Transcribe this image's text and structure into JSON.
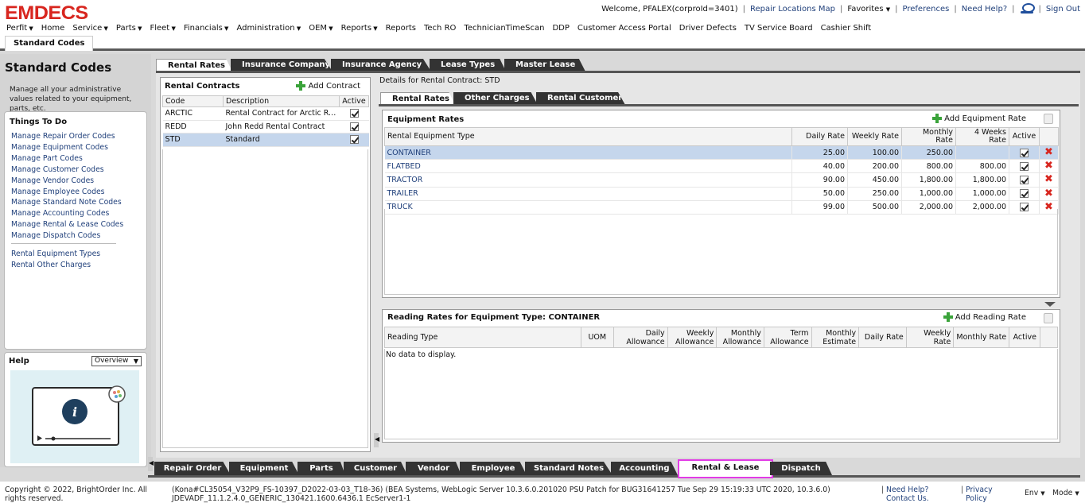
{
  "header": {
    "logo": "EMDECS",
    "welcome": "Welcome, PFALEX(corproId=3401)",
    "repair_map": "Repair Locations Map",
    "favorites": "Favorites",
    "preferences": "Preferences",
    "need_help": "Need Help?",
    "sign_out": "Sign Out"
  },
  "menu": [
    "Perfit",
    "Home",
    "Service",
    "Parts",
    "Fleet",
    "Financials",
    "Administration",
    "OEM",
    "Reports",
    "Reports",
    "Tech RO",
    "TechnicianTimeScan",
    "DDP",
    "Customer Access Portal",
    "Driver Defects",
    "TV Service Board",
    "Cashier Shift"
  ],
  "menu_carets": [
    true,
    false,
    true,
    true,
    true,
    true,
    true,
    true,
    true,
    false,
    false,
    false,
    false,
    false,
    false,
    false,
    false
  ],
  "subtab": "Standard Codes",
  "left": {
    "title": "Standard Codes",
    "description": "Manage all your administrative values related to your equipment, parts, etc.",
    "todo_title": "Things To Do",
    "todo": [
      "Manage Repair Order Codes",
      "Manage Equipment Codes",
      "Manage Part Codes",
      "Manage Customer Codes",
      "Manage Vendor Codes",
      "Manage Employee Codes",
      "Manage Standard Note Codes",
      "Manage Accounting Codes",
      "Manage Rental & Lease Codes",
      "Manage Dispatch Codes"
    ],
    "todo2": [
      "Rental Equipment Types",
      "Rental Other Charges"
    ],
    "help_title": "Help",
    "help_select": "Overview"
  },
  "tabs": [
    "Rental Rates",
    "Insurance Company",
    "Insurance Agency",
    "Lease Types",
    "Master Lease"
  ],
  "contracts": {
    "title": "Rental Contracts",
    "add": "Add Contract",
    "headers": [
      "Code",
      "Description",
      "Active"
    ],
    "rows": [
      {
        "code": "ARCTIC",
        "desc": "Rental Contract for Arctic Refr…",
        "active": true
      },
      {
        "code": "REDD",
        "desc": "John Redd Rental Contract",
        "active": true
      },
      {
        "code": "STD",
        "desc": "Standard",
        "active": true
      }
    ]
  },
  "details_label": "Details for Rental Contract: STD",
  "subtabs": [
    "Rental Rates",
    "Other Charges",
    "Rental Customers"
  ],
  "equipment": {
    "title": "Equipment Rates",
    "add": "Add Equipment Rate",
    "headers": [
      "Rental Equipment Type",
      "Daily Rate",
      "Weekly Rate",
      "Monthly Rate",
      "4 Weeks Rate",
      "Active"
    ],
    "rows": [
      {
        "type": "CONTAINER",
        "daily": "25.00",
        "weekly": "100.00",
        "monthly": "250.00",
        "four": ""
      },
      {
        "type": "FLATBED",
        "daily": "40.00",
        "weekly": "200.00",
        "monthly": "800.00",
        "four": "800.00"
      },
      {
        "type": "TRACTOR",
        "daily": "90.00",
        "weekly": "450.00",
        "monthly": "1,800.00",
        "four": "1,800.00"
      },
      {
        "type": "TRAILER",
        "daily": "50.00",
        "weekly": "250.00",
        "monthly": "1,000.00",
        "four": "1,000.00"
      },
      {
        "type": "TRUCK",
        "daily": "99.00",
        "weekly": "500.00",
        "monthly": "2,000.00",
        "four": "2,000.00"
      }
    ]
  },
  "reading": {
    "title": "Reading Rates for Equipment Type: CONTAINER",
    "add": "Add Reading Rate",
    "headers": [
      "Reading Type",
      "UOM",
      "Daily Allowance",
      "Weekly Allowance",
      "Monthly Allowance",
      "Term Allowance",
      "Monthly Estimate",
      "Daily Rate",
      "Weekly Rate",
      "Monthly Rate",
      "Active"
    ],
    "empty": "No data to display."
  },
  "bottom_tabs": [
    "Repair Order",
    "Equipment",
    "Parts",
    "Customer",
    "Vendor",
    "Employee",
    "Standard Notes",
    "Accounting",
    "Rental & Lease",
    "Dispatch"
  ],
  "footer": {
    "copyright": "Copyright © 2022, BrightOrder Inc. All rights reserved.",
    "version": "(Kona#CL35054_V32P9_FS-10397_D2022-03-03_T18-36) (BEA Systems, WebLogic Server 10.3.6.0.201020 PSU Patch for BUG31641257 Tue Sep 29 15:19:33 UTC 2020, 10.3.6.0) JDEVADF_11.1.2.4.0_GENERIC_130421.1600.6436.1 EcServer1-1",
    "help": "Need Help? Contact Us.",
    "privacy": "Privacy Policy",
    "env": "Env",
    "mode": "Mode"
  },
  "colors": {
    "brand": "#d8261f",
    "link": "#1f3f7a",
    "selected_row": "#c5d6ec",
    "highlight_tab": "#e23be6"
  }
}
